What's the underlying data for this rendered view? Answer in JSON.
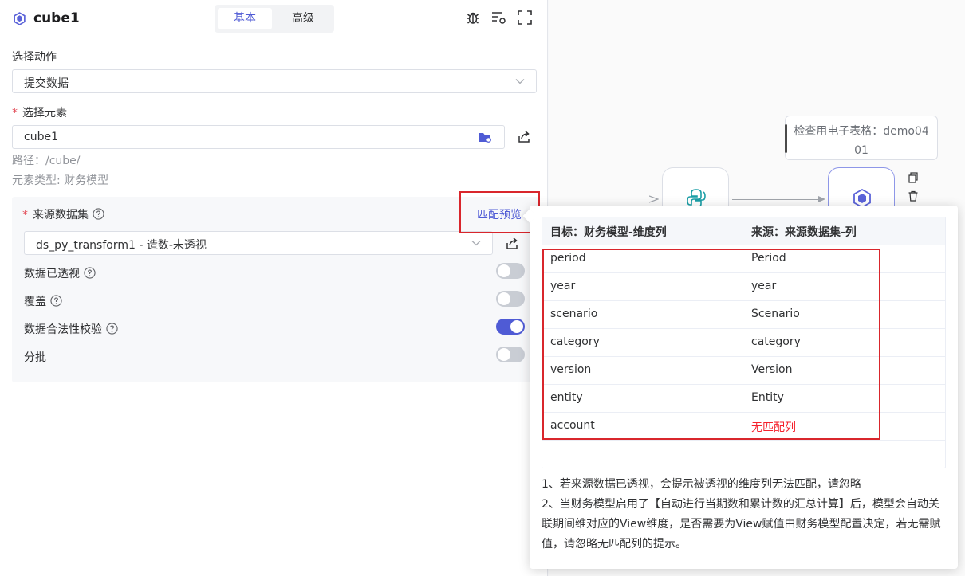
{
  "header": {
    "title": "cube1",
    "tabs": [
      {
        "label": "基本",
        "active": true
      },
      {
        "label": "高级",
        "active": false
      }
    ],
    "icons": [
      "bug-icon",
      "list-settings-icon",
      "fullscreen-icon"
    ]
  },
  "action": {
    "label": "选择动作",
    "value": "提交数据"
  },
  "element": {
    "label": "选择元素",
    "required": "*",
    "value": "cube1",
    "path": "路径：/cube/",
    "type": "元素类型: 财务模型"
  },
  "source": {
    "label": "来源数据集",
    "required": "*",
    "link": "匹配预览",
    "value": "ds_py_transform1 - 造数-未透视",
    "options": [
      {
        "label": "数据已透视",
        "on": false
      },
      {
        "label": "覆盖",
        "on": false
      },
      {
        "label": "数据合法性校验",
        "on": true
      },
      {
        "label": "分批",
        "on": false
      }
    ]
  },
  "canvas": {
    "note": [
      "检查用电子表格：demo04",
      "01"
    ]
  },
  "popover": {
    "head_target": "目标：财务模型-维度列",
    "head_source": "来源：来源数据集-列",
    "rows": [
      {
        "target": "period",
        "source": "Period"
      },
      {
        "target": "year",
        "source": "year"
      },
      {
        "target": "scenario",
        "source": "Scenario"
      },
      {
        "target": "category",
        "source": "category"
      },
      {
        "target": "version",
        "source": "Version"
      },
      {
        "target": "entity",
        "source": "Entity"
      },
      {
        "target": "account",
        "source": "无匹配列",
        "unmatched": true
      }
    ],
    "notes": [
      "1、若来源数据已透视，会提示被透视的维度列无法匹配，请忽略",
      "2、当财务模型启用了【自动进行当期数和累计数的汇总计算】后，模型会自动关联期间维对应的View维度，是否需要为View赋值由财务模型配置决定，若无需赋值，请忽略无匹配列的提示。"
    ]
  },
  "colors": {
    "accent": "#4f5bd5",
    "highlight_box": "#d9262c",
    "unmatched_text": "#f5222d"
  }
}
